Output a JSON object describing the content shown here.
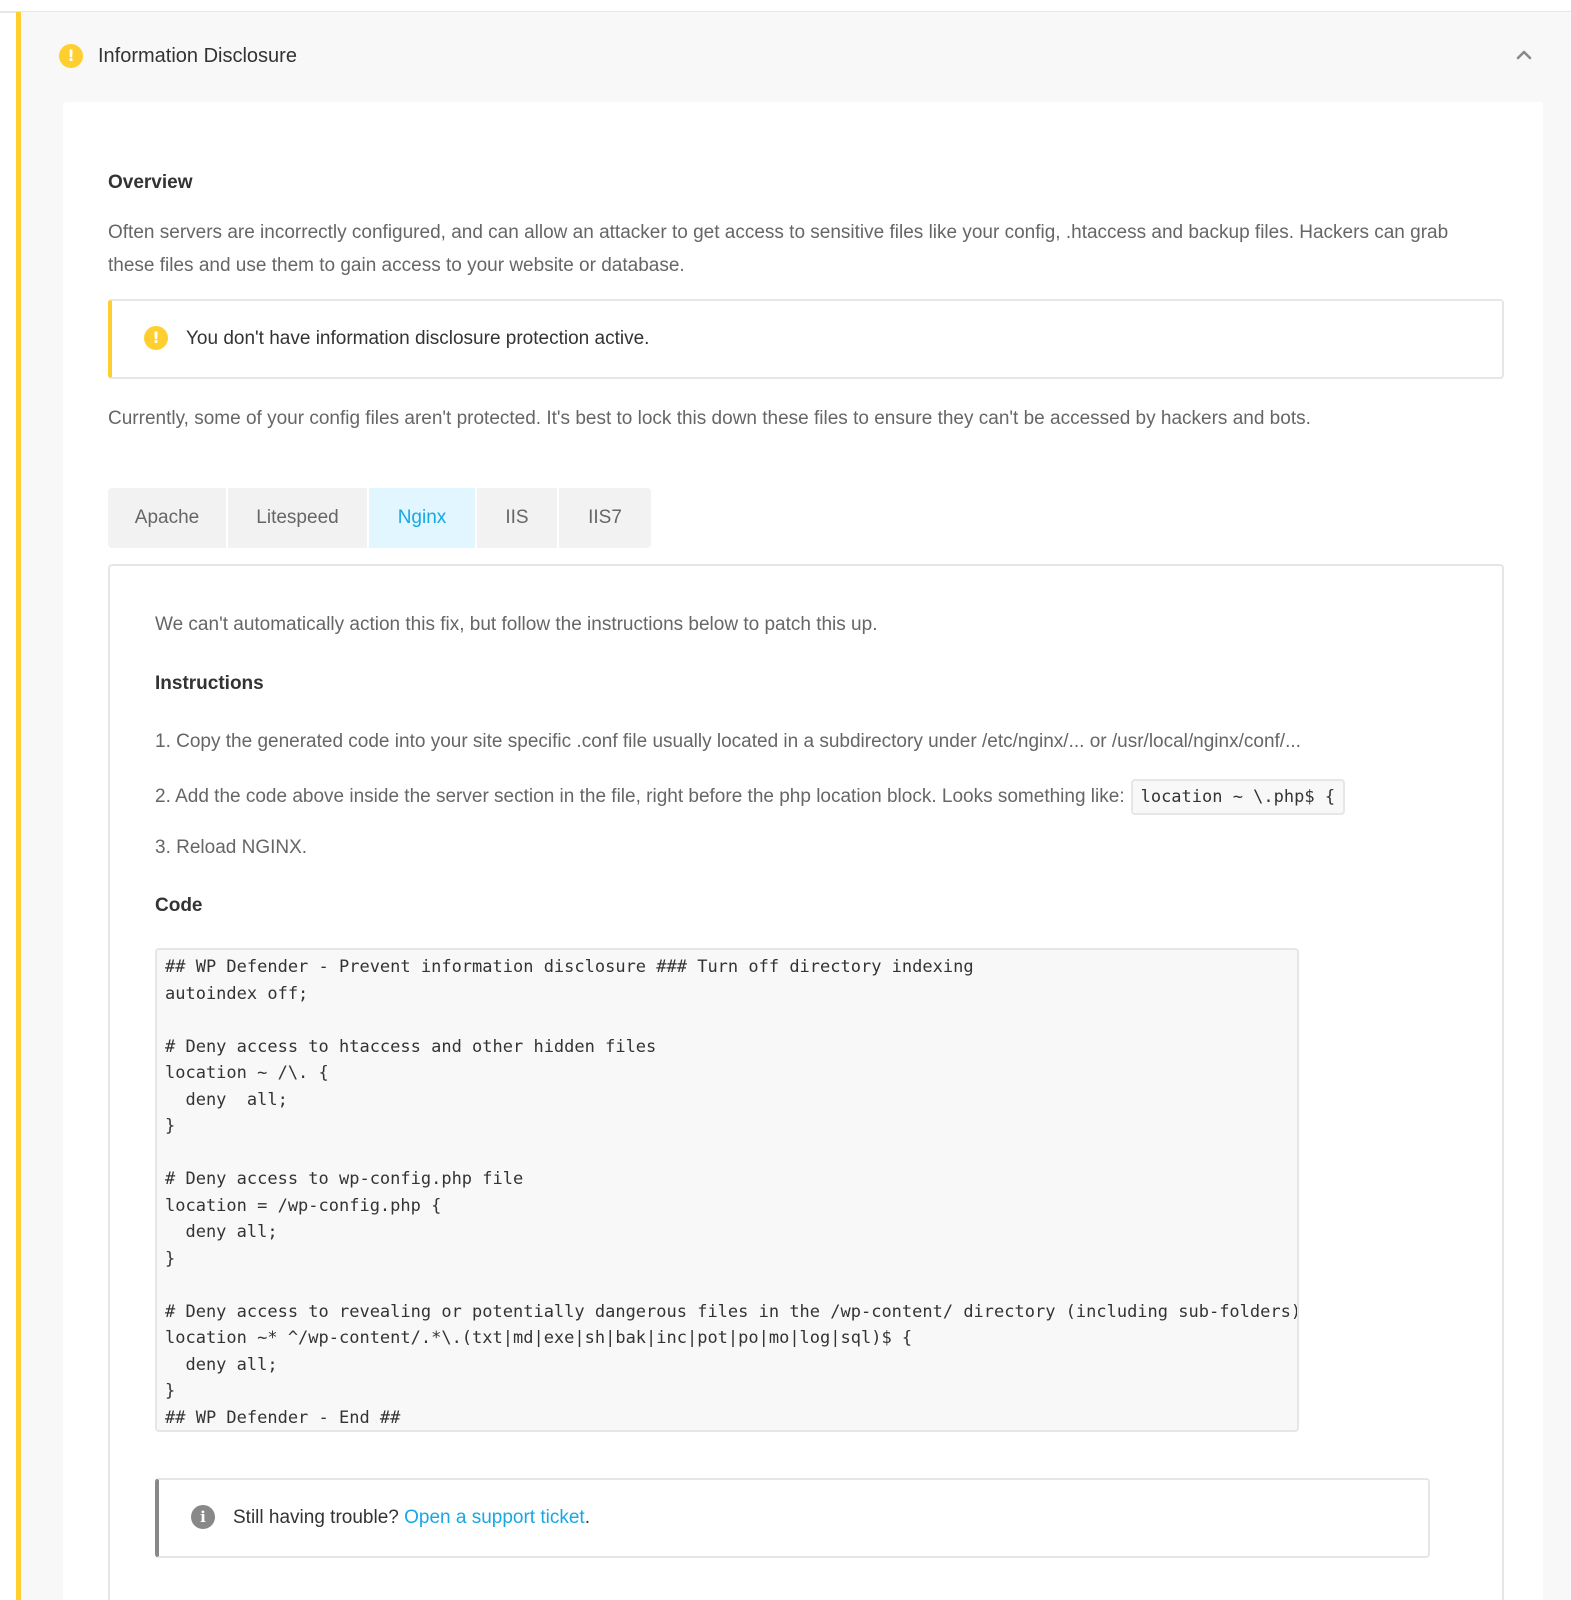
{
  "colors": {
    "warning": "#fecf2f",
    "accent": "#17a8e3",
    "active_tab_bg": "#e1f6ff",
    "info": "#888888"
  },
  "header": {
    "status_icon": "warning-icon",
    "title": "Information Disclosure",
    "toggle_icon": "chevron-up-icon"
  },
  "overview": {
    "heading": "Overview",
    "text": "Often servers are incorrectly configured, and can allow an attacker to get access to sensitive files like your config, .htaccess and backup files. Hackers can grab these files and use them to gain access to your website or database.",
    "notice_icon": "warning-icon",
    "notice_text": "You don't have information disclosure protection active.",
    "status_text": "Currently, some of your config files aren't protected. It's best to lock this down these files to ensure they can't be accessed by hackers and bots."
  },
  "tabs": [
    {
      "label": "Apache",
      "active": false
    },
    {
      "label": "Litespeed",
      "active": false
    },
    {
      "label": "Nginx",
      "active": true
    },
    {
      "label": "IIS",
      "active": false
    },
    {
      "label": "IIS7",
      "active": false
    }
  ],
  "fix": {
    "intro": "We can't automatically action this fix, but follow the instructions below to patch this up.",
    "instructions_heading": "Instructions",
    "step1": "1. Copy the generated code into your site specific .conf file usually located in a subdirectory under /etc/nginx/... or /usr/local/nginx/conf/...",
    "step2": "2. Add the code above inside the server section in the file, right before the php location block. Looks something like:",
    "step2_code": "location ~ \\.php$ {",
    "step3": "3. Reload NGINX.",
    "code_heading": "Code",
    "code": "## WP Defender - Prevent information disclosure ### Turn off directory indexing\nautoindex off;\n\n# Deny access to htaccess and other hidden files\nlocation ~ /\\. {\n  deny  all;\n}\n\n# Deny access to wp-config.php file\nlocation = /wp-config.php {\n  deny all;\n}\n\n# Deny access to revealing or potentially dangerous files in the /wp-content/ directory (including sub-folders)\nlocation ~* ^/wp-content/.*\\.(txt|md|exe|sh|bak|inc|pot|po|mo|log|sql)$ {\n  deny all;\n}\n## WP Defender - End ##"
  },
  "support": {
    "icon": "info-icon",
    "text": "Still having trouble? ",
    "link_label": "Open a support ticket",
    "suffix": "."
  }
}
